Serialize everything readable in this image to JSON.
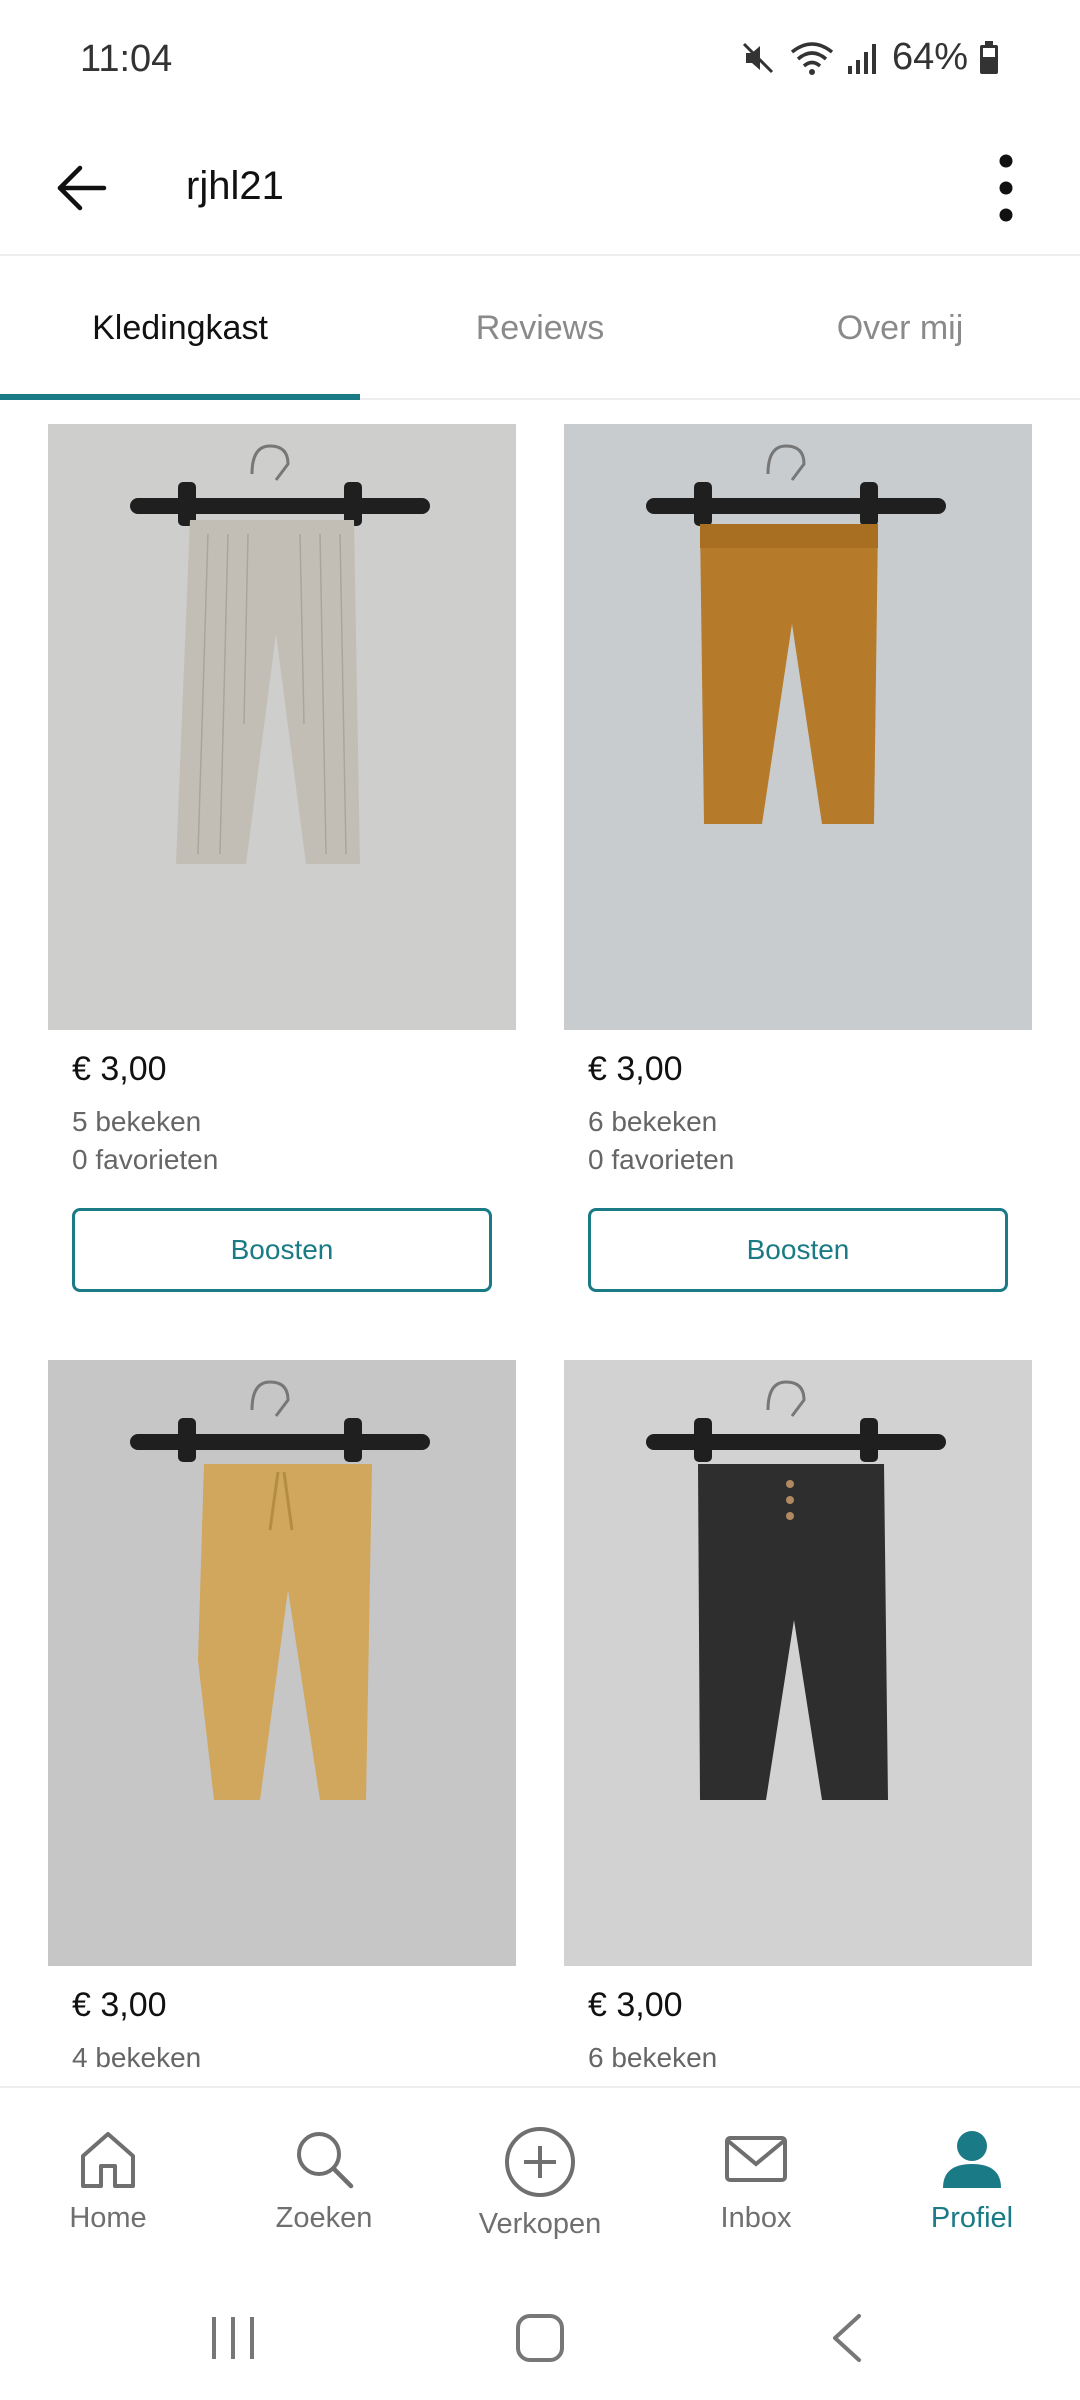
{
  "status_bar": {
    "time": "11:04",
    "battery": "64%",
    "icons": [
      "mute-icon",
      "wifi-icon",
      "signal-icon",
      "battery-icon"
    ]
  },
  "app_bar": {
    "title": "rjhl21",
    "back_icon": "arrow-left-icon",
    "more_icon": "more-vertical-icon"
  },
  "tabs": [
    {
      "label": "Kledingkast",
      "active": true
    },
    {
      "label": "Reviews",
      "active": false
    },
    {
      "label": "Over mij",
      "active": false
    }
  ],
  "items": [
    {
      "price": "€ 3,00",
      "views": "5 bekeken",
      "favorites": "0 favorieten",
      "boost_label": "Boosten",
      "garment_color": "#c9c5bd"
    },
    {
      "price": "€ 3,00",
      "views": "6 bekeken",
      "favorites": "0 favorieten",
      "boost_label": "Boosten",
      "garment_color": "#b57a2a"
    },
    {
      "price": "€ 3,00",
      "views": "4 bekeken",
      "garment_color": "#d0a75c"
    },
    {
      "price": "€ 3,00",
      "views": "6 bekeken",
      "garment_color": "#2e2e2e"
    }
  ],
  "bottom_nav": [
    {
      "label": "Home",
      "icon": "home-icon",
      "active": false
    },
    {
      "label": "Zoeken",
      "icon": "search-icon",
      "active": false
    },
    {
      "label": "Verkopen",
      "icon": "plus-circle-icon",
      "active": false
    },
    {
      "label": "Inbox",
      "icon": "mail-icon",
      "active": false
    },
    {
      "label": "Profiel",
      "icon": "person-icon",
      "active": true
    }
  ],
  "colors": {
    "accent": "#1a7a85",
    "muted_text": "#666666",
    "divider": "#eeeeee"
  }
}
